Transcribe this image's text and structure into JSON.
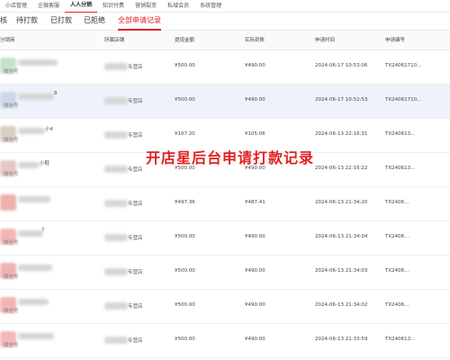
{
  "topnav": [
    {
      "label": "小店管理",
      "active": false
    },
    {
      "label": "企微客服",
      "active": false
    },
    {
      "label": "人人分销",
      "active": true
    },
    {
      "label": "知识付费",
      "active": false
    },
    {
      "label": "营销裂变",
      "active": false
    },
    {
      "label": "私域会员",
      "active": false
    },
    {
      "label": "系统管理",
      "active": false
    }
  ],
  "subtabs": [
    {
      "label": "核",
      "active": false
    },
    {
      "label": "待打款",
      "active": false
    },
    {
      "label": "已打款",
      "active": false
    },
    {
      "label": "已拒绝",
      "active": false
    },
    {
      "label": "全部申请记录",
      "active": true
    }
  ],
  "table": {
    "columns": [
      "分销商",
      "所属店铺",
      "提现金额",
      "实际到账",
      "申请时间",
      "申请编号"
    ],
    "rows": [
      {
        "name_suffix": "",
        "sub": "微信号",
        "shop": "专营店",
        "applied": "¥500.00",
        "actual": "¥490.00",
        "time": "2024-06-17 10:53:06",
        "no": "TX24061710...",
        "avatar_color": "#c8e0cf"
      },
      {
        "name_suffix": "8",
        "sub": "微信号",
        "shop": "专营店",
        "applied": "¥500.00",
        "actual": "¥490.00",
        "time": "2024-06-17 10:52:53",
        "no": "TX24061710...",
        "avatar_color": "#cfd6e8"
      },
      {
        "name_suffix": "小4",
        "sub": "微信号",
        "shop": "专营店",
        "applied": "¥107.20",
        "actual": "¥105.06",
        "time": "2024-06-13 22:16:31",
        "no": "TX240613...",
        "avatar_color": "#d9d0c3"
      },
      {
        "name_suffix": "小鞋",
        "sub": "微信号",
        "shop": "专营店",
        "applied": "¥500.00",
        "actual": "¥490.00",
        "time": "2024-06-13 22:16:22",
        "no": "TX240613...",
        "avatar_color": "#e8c7c7"
      },
      {
        "name_suffix": "",
        "sub": "",
        "shop": "专营店",
        "applied": "¥497.36",
        "actual": "¥487.41",
        "time": "2024-06-13 21:34:20",
        "no": "TX2406...",
        "avatar_color": "#f0b0b0"
      },
      {
        "name_suffix": "7",
        "sub": "微信号",
        "shop": "专营店",
        "applied": "¥500.00",
        "actual": "¥490.00",
        "time": "2024-06-13 21:34:04",
        "no": "TX2406...",
        "avatar_color": "#f2b6b6"
      },
      {
        "name_suffix": "",
        "sub": "微信号",
        "shop": "专营店",
        "applied": "¥500.00",
        "actual": "¥490.00",
        "time": "2024-06-13 21:34:03",
        "no": "TX2406...",
        "avatar_color": "#f0b3b3"
      },
      {
        "name_suffix": "",
        "sub": "微信号",
        "shop": "专营店",
        "applied": "¥500.00",
        "actual": "¥490.00",
        "time": "2024-06-13 21:34:02",
        "no": "TX2406...",
        "avatar_color": "#f1b5b5"
      },
      {
        "name_suffix": "",
        "sub": "微信号",
        "shop": "专营店",
        "applied": "¥500.00",
        "actual": "¥490.00",
        "time": "2024-06-13 21:33:59",
        "no": "TX240613...",
        "avatar_color": "#f2b8b8"
      }
    ]
  },
  "watermark": "开店星后台申请打款记录",
  "colors": {
    "accent": "#e02020",
    "highlight_row": "#eef3fb"
  }
}
